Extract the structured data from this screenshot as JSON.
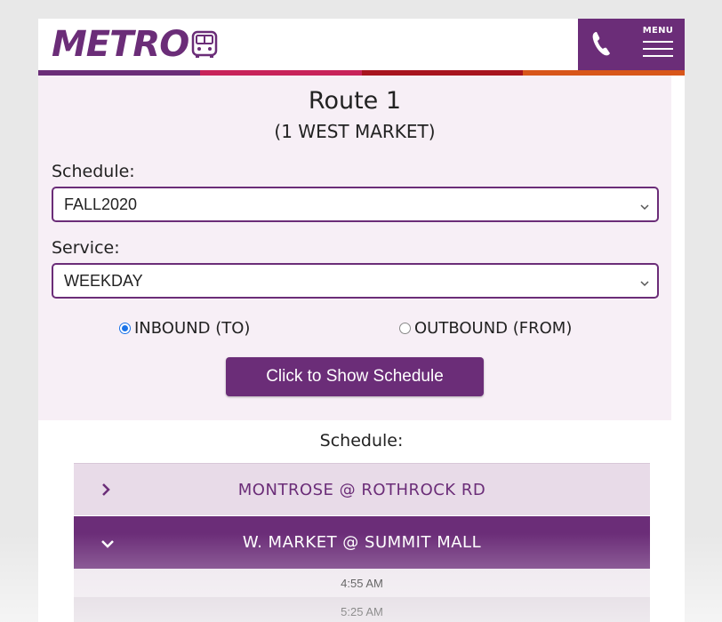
{
  "header": {
    "logo_text": "METRO",
    "menu_label": "MENU",
    "brand_colors": [
      "#6b2d78",
      "#c8235a",
      "#a8141e",
      "#d8561a"
    ]
  },
  "route": {
    "title": "Route 1",
    "subtitle": "(1 WEST MARKET)"
  },
  "form": {
    "schedule_label": "Schedule:",
    "schedule_value": "FALL2020",
    "service_label": "Service:",
    "service_value": "WEEKDAY",
    "direction_options": [
      {
        "label": "INBOUND (TO)",
        "selected": true
      },
      {
        "label": "OUTBOUND (FROM)",
        "selected": false
      }
    ],
    "show_button_label": "Click to Show Schedule"
  },
  "schedule": {
    "heading": "Schedule:",
    "stops": [
      {
        "name": "MONTROSE @ ROTHROCK RD",
        "expanded": false
      },
      {
        "name": "W. MARKET @ SUMMIT MALL",
        "expanded": true,
        "times": [
          "4:55 AM",
          "5:25 AM"
        ]
      }
    ]
  },
  "icons": {
    "bus": "bus-icon",
    "phone": "phone-icon",
    "menu": "hamburger-menu-icon",
    "chevron": "chevron-down-icon",
    "arrow_right": "chevron-right-icon",
    "arrow_down": "chevron-down-icon"
  }
}
